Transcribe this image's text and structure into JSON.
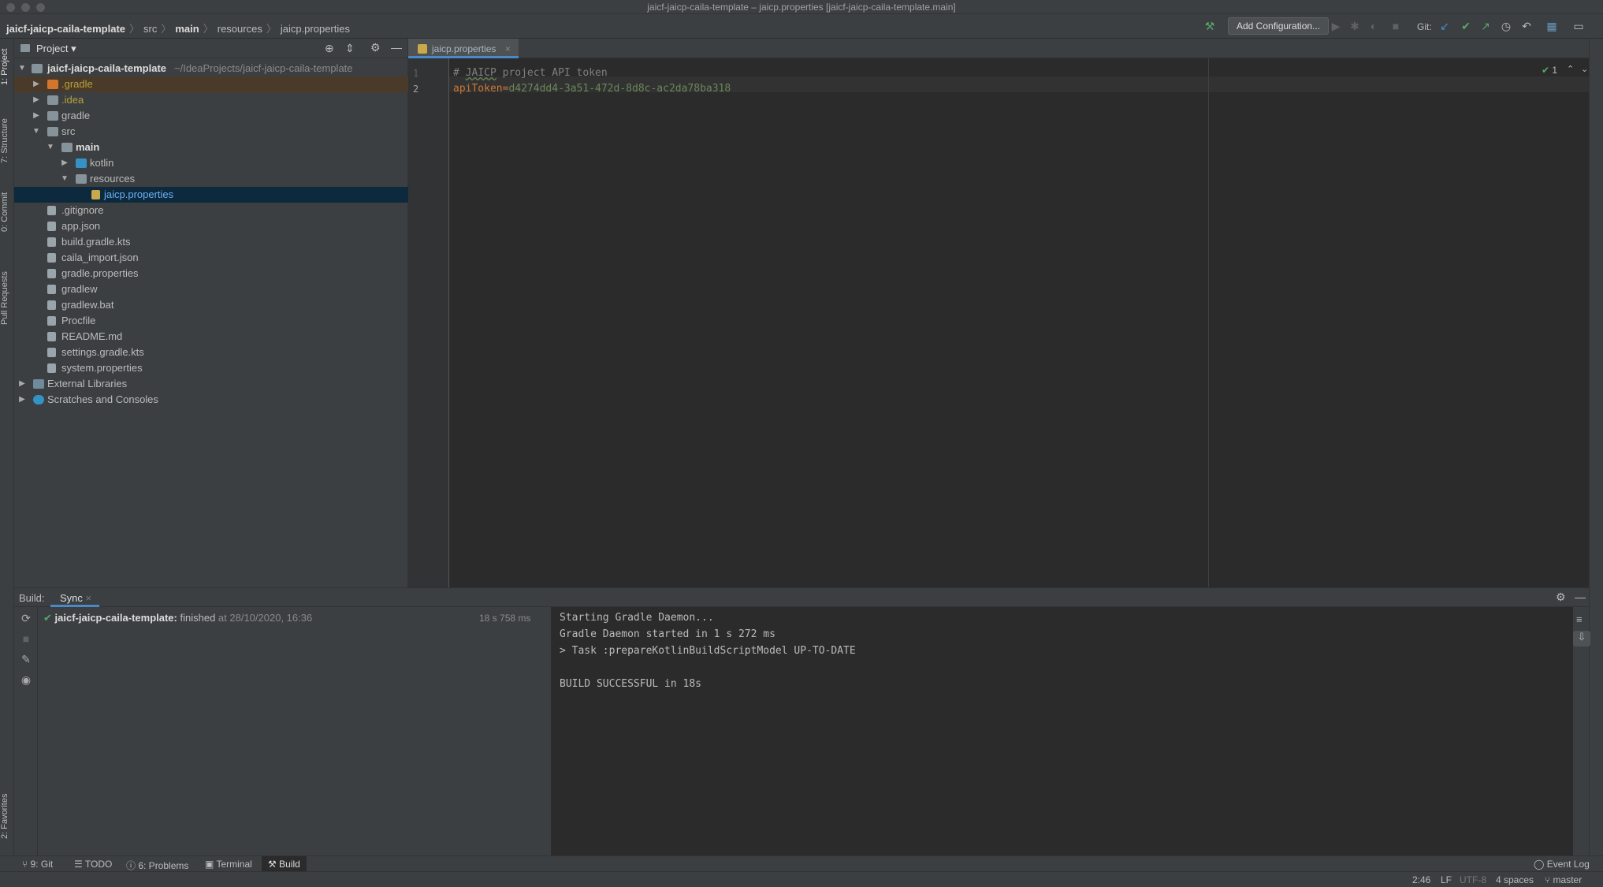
{
  "window_title": "jaicf-jaicp-caila-template – jaicp.properties [jaicf-jaicp-caila-template.main]",
  "breadcrumb": [
    "jaicf-jaicp-caila-template",
    "src",
    "main",
    "resources",
    "jaicp.properties"
  ],
  "toolbar": {
    "add_config_label": "Add Configuration...",
    "git_label": "Git:"
  },
  "left_stripe": [
    "1: Project",
    "7: Structure",
    "0: Commit",
    "Pull Requests",
    "2: Favorites"
  ],
  "project_panel": {
    "title": "Project",
    "root_name": "jaicf-jaicp-caila-template",
    "root_path": "~/IdeaProjects/jaicf-jaicp-caila-template",
    "items": [
      {
        "label": ".gradle"
      },
      {
        "label": ".idea"
      },
      {
        "label": "gradle"
      },
      {
        "label": "src"
      },
      {
        "label": "main"
      },
      {
        "label": "kotlin"
      },
      {
        "label": "resources"
      },
      {
        "label": "jaicp.properties"
      },
      {
        "label": ".gitignore"
      },
      {
        "label": "app.json"
      },
      {
        "label": "build.gradle.kts"
      },
      {
        "label": "caila_import.json"
      },
      {
        "label": "gradle.properties"
      },
      {
        "label": "gradlew"
      },
      {
        "label": "gradlew.bat"
      },
      {
        "label": "Procfile"
      },
      {
        "label": "README.md"
      },
      {
        "label": "settings.gradle.kts"
      },
      {
        "label": "system.properties"
      },
      {
        "label": "External Libraries"
      },
      {
        "label": "Scratches and Consoles"
      }
    ]
  },
  "editor": {
    "tab_label": "jaicp.properties",
    "line_numbers": [
      "1",
      "2"
    ],
    "comment_hash": "#",
    "comment_keyword": "JAICP",
    "comment_rest": "project API token",
    "key": "apiToken",
    "equals": "=",
    "value": "d4274dd4-3a51-472d-8d8c-ac2da78ba318",
    "inspection_count": "1"
  },
  "build": {
    "label": "Build:",
    "tab_label": "Sync",
    "task_name": "jaicf-jaicp-caila-template:",
    "task_status": "finished",
    "task_time": "at 28/10/2020, 16:36",
    "duration": "18 s 758 ms",
    "console": [
      "Starting Gradle Daemon...",
      "Gradle Daemon started in 1 s 272 ms",
      "> Task :prepareKotlinBuildScriptModel UP-TO-DATE",
      "",
      "BUILD SUCCESSFUL in 18s"
    ]
  },
  "bottom_tabs": [
    "9: Git",
    "TODO",
    "6: Problems",
    "Terminal",
    "Build"
  ],
  "event_log": "Event Log",
  "status": {
    "position": "2:46",
    "line_sep": "LF",
    "encoding": "UTF-8",
    "indent": "4 spaces",
    "branch": "master"
  },
  "colors": {
    "keyword": "#cc7832",
    "value": "#6a8759",
    "comment": "#808080",
    "success": "#59a869",
    "accent": "#4a88c7"
  }
}
